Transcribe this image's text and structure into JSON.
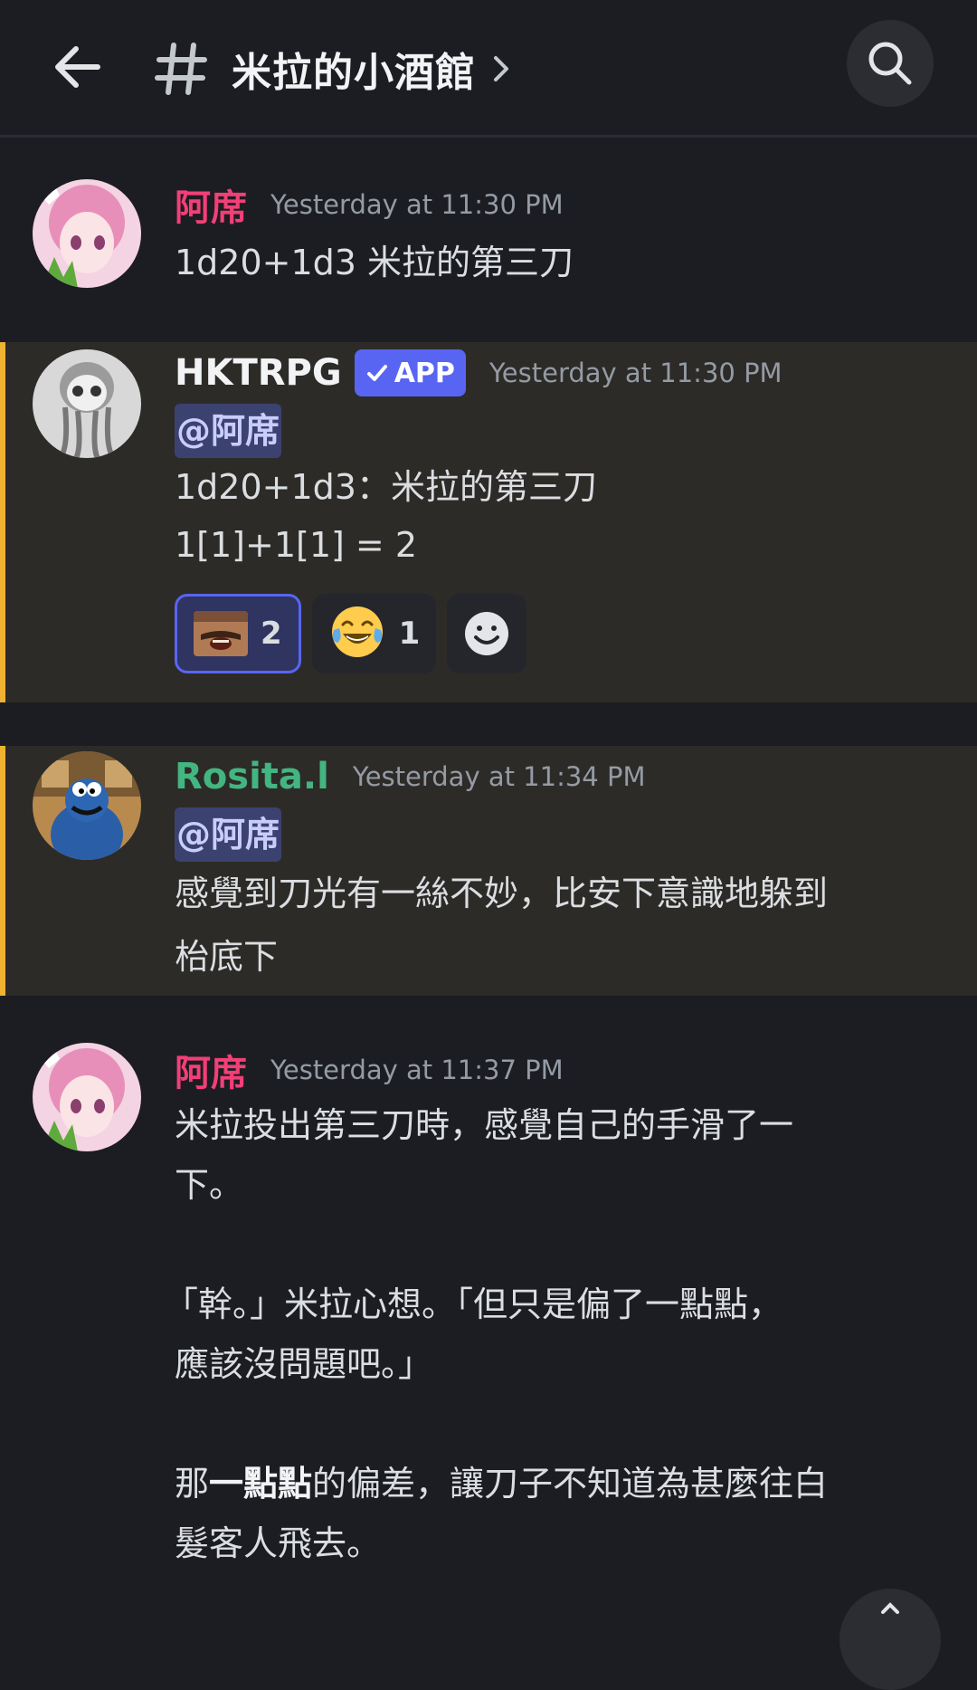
{
  "header": {
    "channel_name": "米拉的小酒館",
    "icons": {
      "back": "arrow-left-icon",
      "channel": "hash-icon",
      "chevron": "chevron-right-icon",
      "search": "search-icon"
    }
  },
  "messages": [
    {
      "author": "阿席",
      "author_color": "#f23f77",
      "timestamp": "Yesterday at 11:30 PM",
      "lines": [
        "1d20+1d3 米拉的第三刀"
      ]
    },
    {
      "author": "HKTRPG",
      "author_color": "#f2f3f5",
      "badge": "APP",
      "timestamp": "Yesterday at 11:30 PM",
      "mention": "@阿席",
      "lines": [
        "1d20+1d3：米拉的第三刀",
        "1[1]+1[1] = 2"
      ],
      "reactions": [
        {
          "emoji": "laughing-man-emoji",
          "count": "2",
          "selected": true
        },
        {
          "emoji": "😂",
          "count": "1",
          "selected": false
        },
        {
          "emoji": "add-reaction-icon",
          "count": "",
          "selected": false
        }
      ]
    },
    {
      "author": "Rosita.l",
      "author_color": "#43b581",
      "timestamp": "Yesterday at 11:34 PM",
      "mention": "@阿席",
      "lines": [
        "感覺到刀光有一絲不妙，比安下意識地躲到",
        "枱底下"
      ]
    },
    {
      "author": "阿席",
      "author_color": "#f23f77",
      "timestamp": "Yesterday at 11:37 PM",
      "lines": [
        "米拉投出第三刀時，感覺自己的手滑了一",
        "下。",
        "",
        "「幹。」米拉心想。「但只是偏了一點點，",
        "應該沒問題吧。」",
        "",
        "那",
        "一點點",
        "的偏差，讓刀子不知道為甚麼往白",
        "髮客人飛去。"
      ]
    }
  ],
  "colors": {
    "background": "#1c1d22",
    "mention_highlight": "#2d2b28",
    "mention_bar": "#f0b232",
    "app_badge": "#5865f2"
  }
}
